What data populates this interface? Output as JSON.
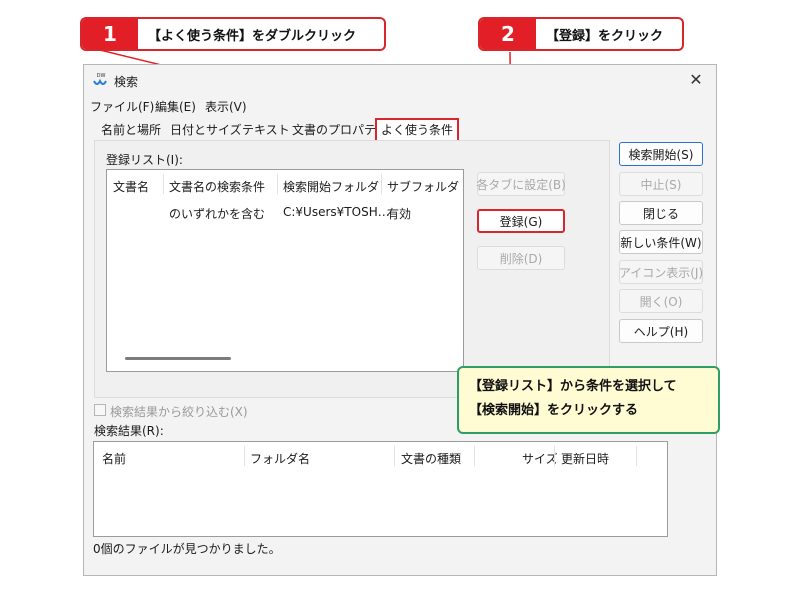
{
  "callouts": [
    {
      "num": "1",
      "text": "【よく使う条件】をダブルクリック"
    },
    {
      "num": "2",
      "text": "【登録】をクリック"
    }
  ],
  "note": {
    "line1": "【登録リスト】から条件を選択して",
    "line2": "【検索開始】をクリックする"
  },
  "window": {
    "icon_label": "DW",
    "title": "検索",
    "close_glyph": "✕",
    "icon": "close-icon"
  },
  "menu": [
    "ファイル(F)",
    "編集(E)",
    "表示(V)"
  ],
  "tabs": [
    "名前と場所",
    "日付とサイズ",
    "テキスト",
    "文書のプロパティ",
    "よく使う条件"
  ],
  "register_list_label": "登録リスト(I):",
  "list_columns": [
    "文書名",
    "文書名の検索条件",
    "検索開始フォルダ",
    "サブフォルダ"
  ],
  "list_rows": [
    [
      "",
      "のいずれかを含む",
      "C:¥Users¥TOSH…",
      "有効"
    ]
  ],
  "mid_buttons": {
    "apply": "各タブに設定(B)",
    "register": "登録(G)",
    "delete": "削除(D)"
  },
  "side_buttons": {
    "start": "検索開始(S)",
    "stop": "中止(S)",
    "close": "閉じる",
    "new": "新しい条件(W)",
    "icon_view": "アイコン表示(J)",
    "open": "開く(O)",
    "help": "ヘルプ(H)"
  },
  "filter_checkbox": "検索結果から絞り込む(X)",
  "results_label": "検索結果(R):",
  "result_columns": [
    "名前",
    "フォルダ名",
    "文書の種類",
    "サイズ",
    "更新日時"
  ],
  "status": "0個のファイルが見つかりました。",
  "colors": {
    "accent_red": "#e21f26",
    "note_green": "#2e9e66",
    "note_bg": "#fffbd2"
  }
}
